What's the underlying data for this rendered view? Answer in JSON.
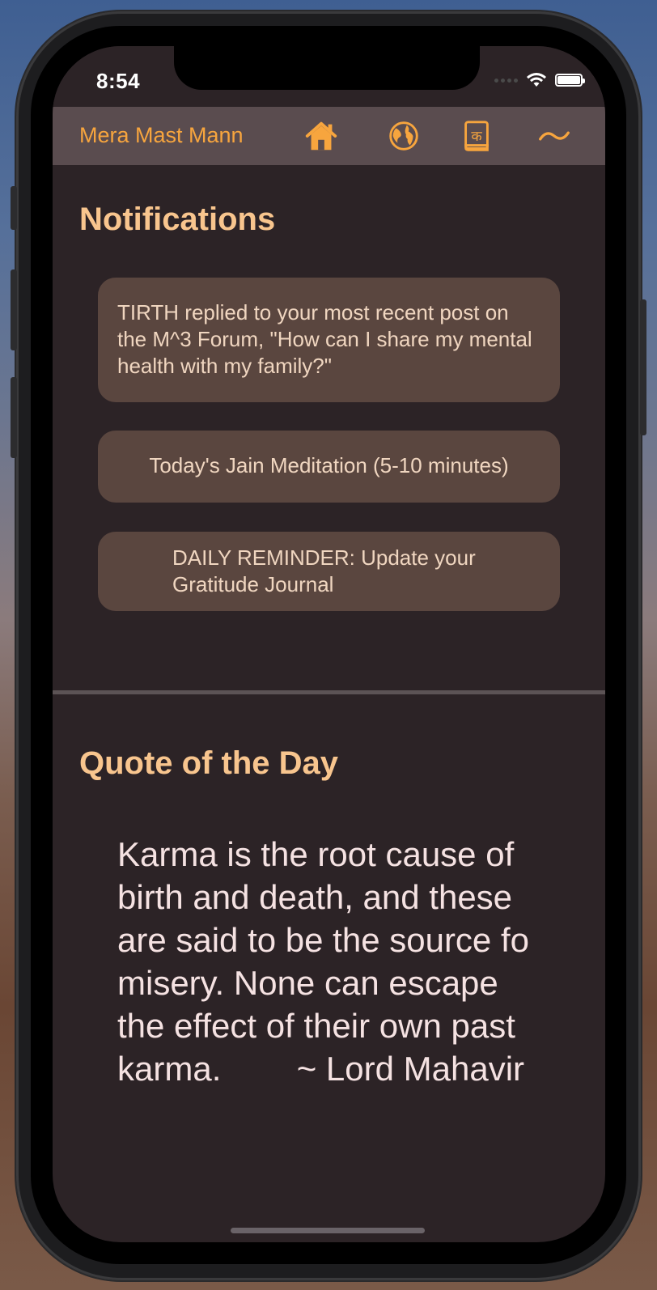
{
  "status_bar": {
    "time": "8:54"
  },
  "nav": {
    "brand": "Mera Mast Mann",
    "icons": [
      "home-icon",
      "globe-icon",
      "book-icon",
      "tilde-icon"
    ],
    "accent_color": "#f7a53e"
  },
  "notifications": {
    "title": "Notifications",
    "items": [
      {
        "text": "TIRTH replied to your most recent post on the M^3 Forum, \"How can I share my mental health with my family?\""
      },
      {
        "text": "Today's Jain Meditation (5-10 minutes)"
      },
      {
        "text": "DAILY REMINDER: Update your Gratitude Journal"
      }
    ]
  },
  "quote": {
    "title": "Quote of the Day",
    "text": "Karma is the root cause of birth and death, and these are said to be the source fo misery. None can escape the effect of their own past karma.        ~ Lord Mahavir"
  }
}
